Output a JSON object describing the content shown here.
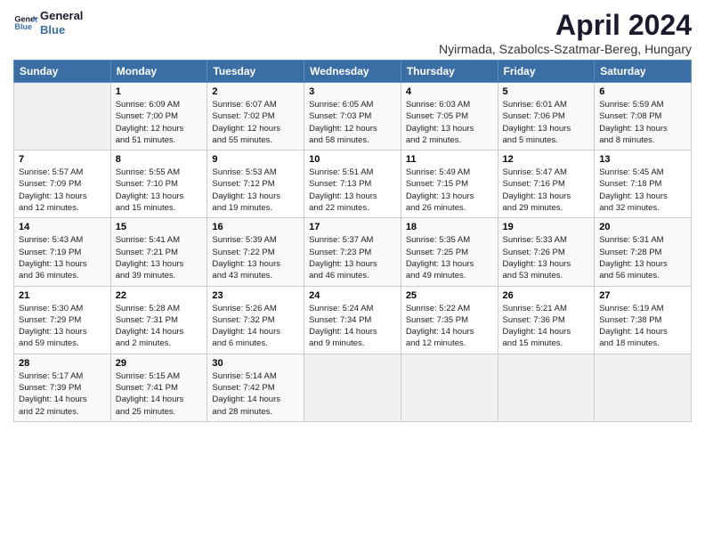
{
  "logo": {
    "line1": "General",
    "line2": "Blue"
  },
  "title": "April 2024",
  "subtitle": "Nyirmada, Szabolcs-Szatmar-Bereg, Hungary",
  "headers": [
    "Sunday",
    "Monday",
    "Tuesday",
    "Wednesday",
    "Thursday",
    "Friday",
    "Saturday"
  ],
  "weeks": [
    [
      {
        "day": "",
        "info": ""
      },
      {
        "day": "1",
        "info": "Sunrise: 6:09 AM\nSunset: 7:00 PM\nDaylight: 12 hours\nand 51 minutes."
      },
      {
        "day": "2",
        "info": "Sunrise: 6:07 AM\nSunset: 7:02 PM\nDaylight: 12 hours\nand 55 minutes."
      },
      {
        "day": "3",
        "info": "Sunrise: 6:05 AM\nSunset: 7:03 PM\nDaylight: 12 hours\nand 58 minutes."
      },
      {
        "day": "4",
        "info": "Sunrise: 6:03 AM\nSunset: 7:05 PM\nDaylight: 13 hours\nand 2 minutes."
      },
      {
        "day": "5",
        "info": "Sunrise: 6:01 AM\nSunset: 7:06 PM\nDaylight: 13 hours\nand 5 minutes."
      },
      {
        "day": "6",
        "info": "Sunrise: 5:59 AM\nSunset: 7:08 PM\nDaylight: 13 hours\nand 8 minutes."
      }
    ],
    [
      {
        "day": "7",
        "info": "Sunrise: 5:57 AM\nSunset: 7:09 PM\nDaylight: 13 hours\nand 12 minutes."
      },
      {
        "day": "8",
        "info": "Sunrise: 5:55 AM\nSunset: 7:10 PM\nDaylight: 13 hours\nand 15 minutes."
      },
      {
        "day": "9",
        "info": "Sunrise: 5:53 AM\nSunset: 7:12 PM\nDaylight: 13 hours\nand 19 minutes."
      },
      {
        "day": "10",
        "info": "Sunrise: 5:51 AM\nSunset: 7:13 PM\nDaylight: 13 hours\nand 22 minutes."
      },
      {
        "day": "11",
        "info": "Sunrise: 5:49 AM\nSunset: 7:15 PM\nDaylight: 13 hours\nand 26 minutes."
      },
      {
        "day": "12",
        "info": "Sunrise: 5:47 AM\nSunset: 7:16 PM\nDaylight: 13 hours\nand 29 minutes."
      },
      {
        "day": "13",
        "info": "Sunrise: 5:45 AM\nSunset: 7:18 PM\nDaylight: 13 hours\nand 32 minutes."
      }
    ],
    [
      {
        "day": "14",
        "info": "Sunrise: 5:43 AM\nSunset: 7:19 PM\nDaylight: 13 hours\nand 36 minutes."
      },
      {
        "day": "15",
        "info": "Sunrise: 5:41 AM\nSunset: 7:21 PM\nDaylight: 13 hours\nand 39 minutes."
      },
      {
        "day": "16",
        "info": "Sunrise: 5:39 AM\nSunset: 7:22 PM\nDaylight: 13 hours\nand 43 minutes."
      },
      {
        "day": "17",
        "info": "Sunrise: 5:37 AM\nSunset: 7:23 PM\nDaylight: 13 hours\nand 46 minutes."
      },
      {
        "day": "18",
        "info": "Sunrise: 5:35 AM\nSunset: 7:25 PM\nDaylight: 13 hours\nand 49 minutes."
      },
      {
        "day": "19",
        "info": "Sunrise: 5:33 AM\nSunset: 7:26 PM\nDaylight: 13 hours\nand 53 minutes."
      },
      {
        "day": "20",
        "info": "Sunrise: 5:31 AM\nSunset: 7:28 PM\nDaylight: 13 hours\nand 56 minutes."
      }
    ],
    [
      {
        "day": "21",
        "info": "Sunrise: 5:30 AM\nSunset: 7:29 PM\nDaylight: 13 hours\nand 59 minutes."
      },
      {
        "day": "22",
        "info": "Sunrise: 5:28 AM\nSunset: 7:31 PM\nDaylight: 14 hours\nand 2 minutes."
      },
      {
        "day": "23",
        "info": "Sunrise: 5:26 AM\nSunset: 7:32 PM\nDaylight: 14 hours\nand 6 minutes."
      },
      {
        "day": "24",
        "info": "Sunrise: 5:24 AM\nSunset: 7:34 PM\nDaylight: 14 hours\nand 9 minutes."
      },
      {
        "day": "25",
        "info": "Sunrise: 5:22 AM\nSunset: 7:35 PM\nDaylight: 14 hours\nand 12 minutes."
      },
      {
        "day": "26",
        "info": "Sunrise: 5:21 AM\nSunset: 7:36 PM\nDaylight: 14 hours\nand 15 minutes."
      },
      {
        "day": "27",
        "info": "Sunrise: 5:19 AM\nSunset: 7:38 PM\nDaylight: 14 hours\nand 18 minutes."
      }
    ],
    [
      {
        "day": "28",
        "info": "Sunrise: 5:17 AM\nSunset: 7:39 PM\nDaylight: 14 hours\nand 22 minutes."
      },
      {
        "day": "29",
        "info": "Sunrise: 5:15 AM\nSunset: 7:41 PM\nDaylight: 14 hours\nand 25 minutes."
      },
      {
        "day": "30",
        "info": "Sunrise: 5:14 AM\nSunset: 7:42 PM\nDaylight: 14 hours\nand 28 minutes."
      },
      {
        "day": "",
        "info": ""
      },
      {
        "day": "",
        "info": ""
      },
      {
        "day": "",
        "info": ""
      },
      {
        "day": "",
        "info": ""
      }
    ]
  ]
}
